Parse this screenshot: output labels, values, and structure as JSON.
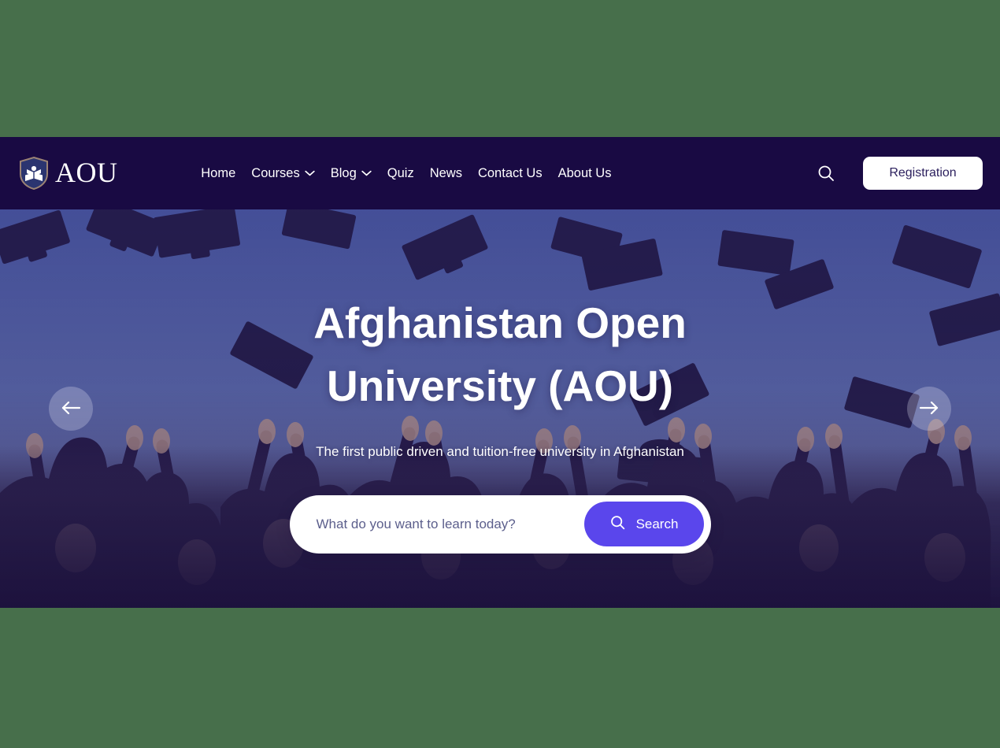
{
  "theme": {
    "page_background": "#476F4B",
    "navbar_background": "#190A43",
    "accent": "#5A46EC",
    "button_text": "#ffffff",
    "registration_text": "#2A1E5C"
  },
  "navbar": {
    "brand": {
      "text": "AOU",
      "logo_icon": "shield-book-icon"
    },
    "menu": [
      {
        "label": "Home",
        "has_dropdown": false
      },
      {
        "label": "Courses",
        "has_dropdown": true,
        "dropdown_icon": "chevron-down-icon"
      },
      {
        "label": "Blog",
        "has_dropdown": true,
        "dropdown_icon": "chevron-down-icon"
      },
      {
        "label": "Quiz",
        "has_dropdown": false
      },
      {
        "label": "News",
        "has_dropdown": false
      },
      {
        "label": "Contact Us",
        "has_dropdown": false
      },
      {
        "label": "About Us",
        "has_dropdown": false
      }
    ],
    "search_icon": "search-icon",
    "registration_label": "Registration"
  },
  "hero": {
    "title": "Afghanistan Open University (AOU)",
    "subtitle": "The first public driven and tuition-free university in Afghanistan",
    "search": {
      "placeholder": "What do you want to learn today?",
      "value": "",
      "button_label": "Search",
      "button_icon": "search-icon"
    },
    "carousel": {
      "prev_icon": "arrow-left-icon",
      "next_icon": "arrow-right-icon"
    },
    "image_description": "Graduates throwing mortarboard caps into a blue sky"
  }
}
